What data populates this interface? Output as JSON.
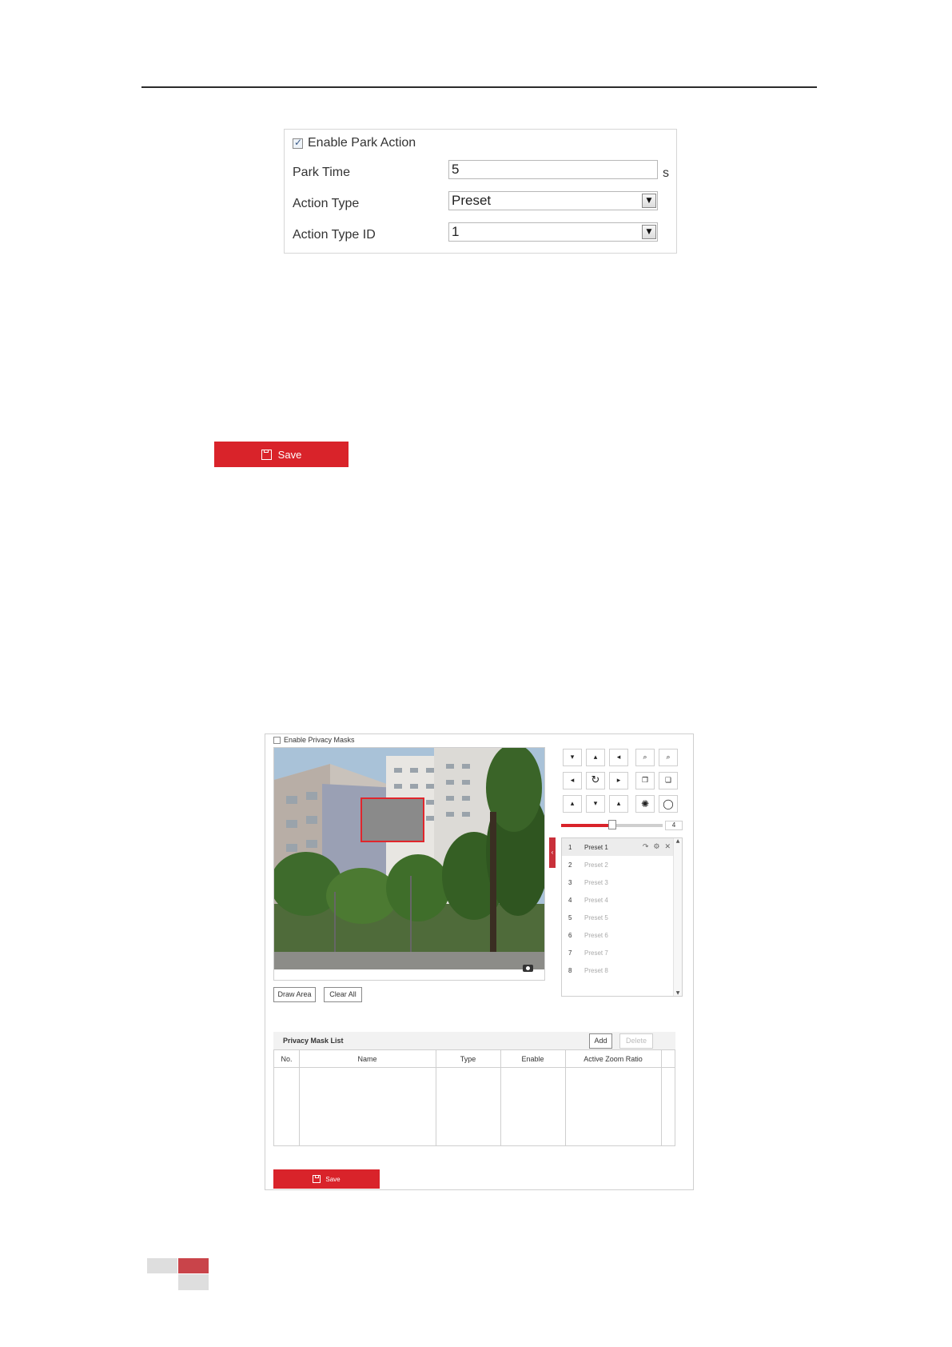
{
  "park_action": {
    "enable_label": "Enable Park Action",
    "enable_checked": true,
    "park_time_label": "Park Time",
    "park_time_value": "5",
    "park_time_unit": "s",
    "action_type_label": "Action Type",
    "action_type_value": "Preset",
    "action_type_id_label": "Action Type ID",
    "action_type_id_value": "1",
    "save_label": "Save"
  },
  "privacy_mask": {
    "enable_label": "Enable Privacy Masks",
    "enable_checked": false,
    "ptz_speed": "4",
    "ptz_speed_fraction": 0.5,
    "presets": [
      {
        "no": "1",
        "name": "Preset 1"
      },
      {
        "no": "2",
        "name": "Preset 2"
      },
      {
        "no": "3",
        "name": "Preset 3"
      },
      {
        "no": "4",
        "name": "Preset 4"
      },
      {
        "no": "5",
        "name": "Preset 5"
      },
      {
        "no": "6",
        "name": "Preset 6"
      },
      {
        "no": "7",
        "name": "Preset 7"
      },
      {
        "no": "8",
        "name": "Preset 8"
      }
    ],
    "draw_area_label": "Draw Area",
    "clear_all_label": "Clear All",
    "list_title": "Privacy Mask List",
    "add_label": "Add",
    "delete_label": "Delete",
    "columns": [
      "No.",
      "Name",
      "Type",
      "Enable",
      "Active Zoom Ratio"
    ],
    "save_label": "Save"
  },
  "colors": {
    "accent": "#d9232a",
    "mask": "#8a8a8a"
  }
}
